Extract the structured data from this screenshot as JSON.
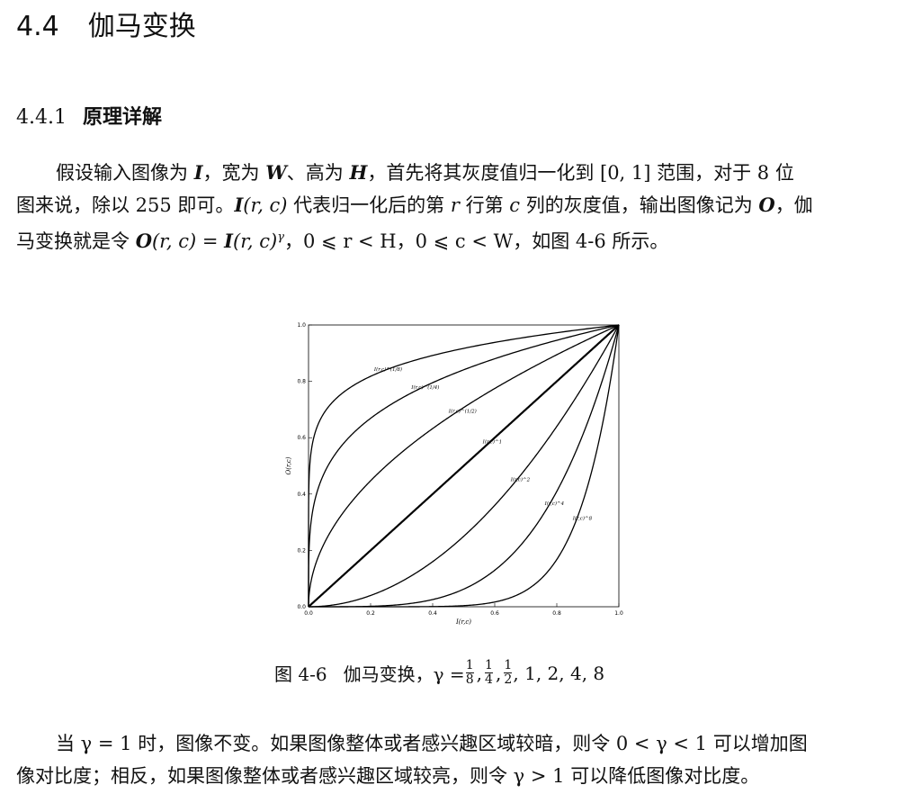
{
  "section": {
    "number": "4.4",
    "title": "伽马变换"
  },
  "subsection": {
    "number": "4.4.1",
    "title": "原理详解"
  },
  "para1": {
    "l1_a": "假设输入图像为 ",
    "l1_I": "I",
    "l1_b": "，宽为 ",
    "l1_W": "W",
    "l1_c": "、高为 ",
    "l1_H": "H",
    "l1_d": "，首先将其灰度值归一化到 [0, 1] 范围，对于 8 位",
    "l2_a": "图来说，除以 255 即可。",
    "l2_Irc": "I",
    "l2_rc": "(r, c)",
    "l2_b": " 代表归一化后的第 ",
    "l2_r": "r",
    "l2_c": " 行第 ",
    "l2_cc": "c",
    "l2_d": " 列的灰度值，输出图像记为 ",
    "l2_O": "O",
    "l2_e": "，伽",
    "l3_a": "马变换就是令 ",
    "l3_O": "O",
    "l3_rc1": "(r, c) = ",
    "l3_I": "I",
    "l3_rc2": "(r, c)",
    "l3_gamma": "γ",
    "l3_b": "，0 ⩽ r < H，0 ⩽ c < W，如图 4-6 所示。"
  },
  "figure": {
    "caption_label": "图 4-6",
    "caption_text": "伽马变换，γ = ",
    "frac_num": "1",
    "frac_dens": [
      "8",
      "4",
      "2"
    ],
    "caption_tail": ", 1, 2, 4, 8"
  },
  "chart_data": {
    "type": "line",
    "xlabel": "I(r,c)",
    "ylabel": "O(r,c)",
    "xlim": [
      0.0,
      1.0
    ],
    "ylim": [
      0.0,
      1.0
    ],
    "xticks": [
      "0.0",
      "0.2",
      "0.4",
      "0.6",
      "0.8",
      "1.0"
    ],
    "yticks": [
      "0.0",
      "0.2",
      "0.4",
      "0.6",
      "0.8",
      "1.0"
    ],
    "grid": false,
    "series": [
      {
        "name": "I(r,c)^(1/8)",
        "gamma": 0.125
      },
      {
        "name": "I(r,c)^(1/4)",
        "gamma": 0.25
      },
      {
        "name": "I(r,c)^(1/2)",
        "gamma": 0.5
      },
      {
        "name": "I(r,c)^1",
        "gamma": 1
      },
      {
        "name": "I(r,c)^2",
        "gamma": 2
      },
      {
        "name": "I(r,c)^4",
        "gamma": 4
      },
      {
        "name": "I(r,c)^8",
        "gamma": 8
      }
    ]
  },
  "para2": {
    "l1": "当 γ = 1 时，图像不变。如果图像整体或者感兴趣区域较暗，则令 0 < γ < 1 可以增加图",
    "l2": "像对比度；相反，如果图像整体或者感兴趣区域较亮，则令 γ > 1 可以降低图像对比度。"
  }
}
